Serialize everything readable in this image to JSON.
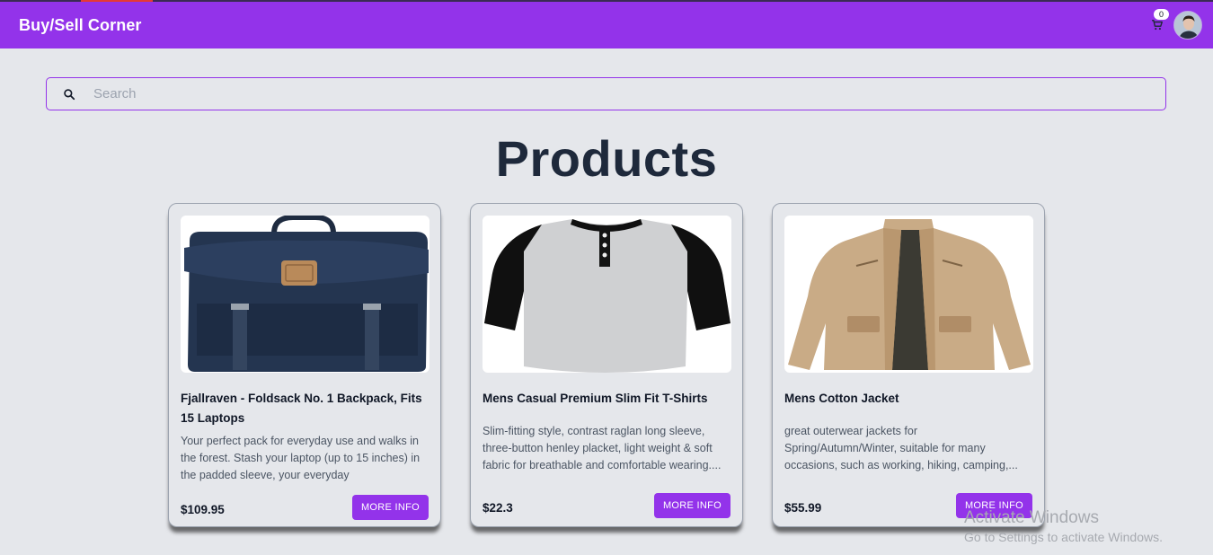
{
  "navbar": {
    "brand": "Buy/Sell Corner",
    "cart_count": "0",
    "colors": {
      "primary": "#9333ea"
    }
  },
  "search": {
    "placeholder": "Search",
    "value": ""
  },
  "page": {
    "heading": "Products"
  },
  "products": [
    {
      "title": "Fjallraven - Foldsack No. 1 Backpack, Fits 15 Laptops",
      "description": "Your perfect pack for everyday use and walks in the forest. Stash your laptop (up to 15 inches) in the padded sleeve, your everyday",
      "price": "$109.95",
      "button_label": "MORE INFO",
      "image_icon": "backpack"
    },
    {
      "title": "Mens Casual Premium Slim Fit T-Shirts",
      "description": "Slim-fitting style, contrast raglan long sleeve, three-button henley placket, light weight & soft fabric for breathable and comfortable wearing....",
      "price": "$22.3",
      "button_label": "MORE INFO",
      "image_icon": "tshirt"
    },
    {
      "title": "Mens Cotton Jacket",
      "description": "great outerwear jackets for Spring/Autumn/Winter, suitable for many occasions, such as working, hiking, camping,...",
      "price": "$55.99",
      "button_label": "MORE INFO",
      "image_icon": "jacket"
    }
  ],
  "watermark": {
    "line1": "Activate Windows",
    "line2": "Go to Settings to activate Windows."
  }
}
